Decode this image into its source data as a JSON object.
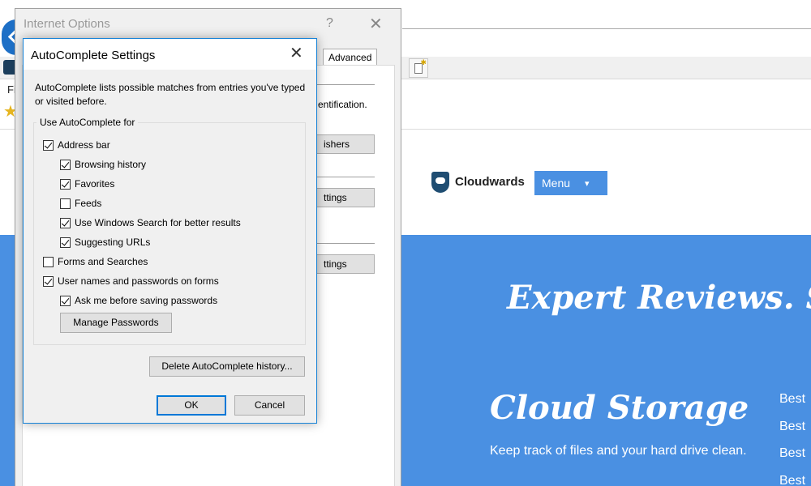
{
  "browser": {
    "menu_letter": "Fi"
  },
  "website": {
    "brand": "Cloudwards",
    "menu_label": "Menu",
    "hero_title": "Expert Reviews. Sin",
    "section_title": "Cloud Storage",
    "section_desc": "Keep track of files and your hard drive clean.",
    "best_items": [
      "Best",
      "Best",
      "Best",
      "Best"
    ],
    "accent_color": "#4a90e2"
  },
  "internet_options": {
    "title": "Internet Options",
    "help": "?",
    "close": "✕",
    "tab_advanced": "Advanced",
    "partial_text": "entification.",
    "btn_publishers": "ishers",
    "btn_settings_1": "ttings",
    "btn_settings_2": "ttings"
  },
  "dialog": {
    "title": "AutoComplete Settings",
    "close": "✕",
    "description": "AutoComplete lists possible matches from entries you've typed or visited before.",
    "group_label": "Use AutoComplete for",
    "options": {
      "address_bar": {
        "label": "Address bar",
        "checked": true
      },
      "browsing_history": {
        "label": "Browsing history",
        "checked": true
      },
      "favorites": {
        "label": "Favorites",
        "checked": true
      },
      "feeds": {
        "label": "Feeds",
        "checked": false
      },
      "windows_search": {
        "label": "Use Windows Search for better results",
        "checked": true
      },
      "suggesting_urls": {
        "label": "Suggesting URLs",
        "checked": true
      },
      "forms_searches": {
        "label": "Forms and Searches",
        "checked": false
      },
      "usernames_passwords": {
        "label": "User names and passwords on forms",
        "checked": true
      },
      "ask_before_saving": {
        "label": "Ask me before saving passwords",
        "checked": true
      }
    },
    "manage_passwords": "Manage Passwords",
    "delete_history": "Delete AutoComplete history...",
    "ok": "OK",
    "cancel": "Cancel",
    "accent_color": "#0078d7"
  }
}
